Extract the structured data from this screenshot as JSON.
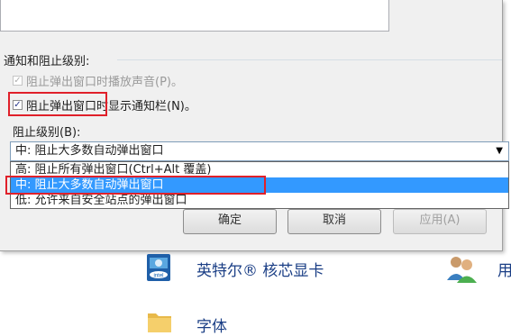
{
  "group": {
    "title": "通知和阻止级别:"
  },
  "options": {
    "play_sound": {
      "label": "阻止弹出窗口时播放声音(P)。",
      "checked": true,
      "enabled": false
    },
    "show_bar": {
      "label": "阻止弹出窗口时显示通知栏(N)。",
      "checked": true,
      "enabled": true
    }
  },
  "level": {
    "label": "阻止级别(B):",
    "selected": "中: 阻止大多数自动弹出窗口",
    "options": [
      "高: 阻止所有弹出窗口(Ctrl+Alt 覆盖)",
      "中: 阻止大多数自动弹出窗口",
      "低: 允许来自安全站点的弹出窗口"
    ]
  },
  "buttons": {
    "ok": "确定",
    "cancel": "取消",
    "apply": "应用(A)"
  },
  "control_panel": {
    "items": [
      {
        "label": "英特尔® 核芯显卡",
        "icon": "intel-graphics-icon"
      },
      {
        "label": "用",
        "icon": "users-icon"
      },
      {
        "label": "字体",
        "icon": "fonts-folder-icon"
      }
    ]
  },
  "colors": {
    "highlight": "#3399ff",
    "annotation_red": "#e0202a",
    "link_blue": "#1a3e85"
  }
}
